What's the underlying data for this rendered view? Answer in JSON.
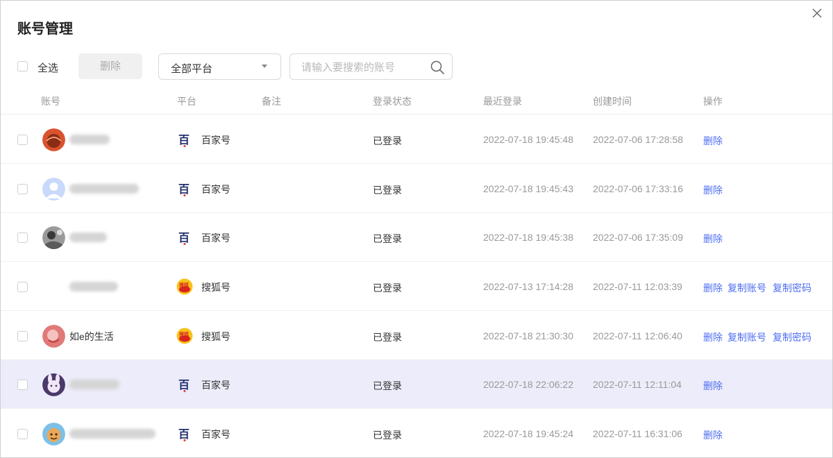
{
  "dialog": {
    "title": "账号管理"
  },
  "toolbar": {
    "select_all_label": "全选",
    "delete_label": "删除",
    "platform_value": "全部平台",
    "search_placeholder": "请输入要搜索的账号"
  },
  "table": {
    "headers": {
      "account": "账号",
      "platform": "平台",
      "note": "备注",
      "login_status": "登录状态",
      "last_login": "最近登录",
      "created": "创建时间",
      "actions": "操作"
    },
    "rows": [
      {
        "name": "",
        "platform": "百家号",
        "platform_icon": "baijiahao-icon",
        "note": "",
        "status": "已登录",
        "last_login": "2022-07-18 19:45:48",
        "created": "2022-07-06 17:28:58",
        "actions": [
          "删除"
        ]
      },
      {
        "name": "",
        "platform": "百家号",
        "platform_icon": "baijiahao-icon",
        "note": "",
        "status": "已登录",
        "last_login": "2022-07-18 19:45:43",
        "created": "2022-07-06 17:33:16",
        "actions": [
          "删除"
        ]
      },
      {
        "name": "",
        "platform": "百家号",
        "platform_icon": "baijiahao-icon",
        "note": "",
        "status": "已登录",
        "last_login": "2022-07-18 19:45:38",
        "created": "2022-07-06 17:35:09",
        "actions": [
          "删除"
        ]
      },
      {
        "name": "",
        "platform": "搜狐号",
        "platform_icon": "sohu-icon",
        "note": "",
        "status": "已登录",
        "last_login": "2022-07-13 17:14:28",
        "created": "2022-07-11 12:03:39",
        "actions": [
          "删除",
          "复制账号",
          "复制密码"
        ]
      },
      {
        "name": "如e的生活",
        "platform": "搜狐号",
        "platform_icon": "sohu-icon",
        "note": "",
        "status": "已登录",
        "last_login": "2022-07-18 21:30:30",
        "created": "2022-07-11 12:06:40",
        "actions": [
          "删除",
          "复制账号",
          "复制密码"
        ]
      },
      {
        "name": "",
        "platform": "百家号",
        "platform_icon": "baijiahao-icon",
        "note": "",
        "status": "已登录",
        "last_login": "2022-07-18 22:06:22",
        "created": "2022-07-11 12:11:04",
        "actions": [
          "删除"
        ]
      },
      {
        "name": "",
        "platform": "百家号",
        "platform_icon": "baijiahao-icon",
        "note": "",
        "status": "已登录",
        "last_login": "2022-07-18 19:45:24",
        "created": "2022-07-11 16:31:06",
        "actions": [
          "删除"
        ]
      }
    ]
  },
  "colors": {
    "link": "#4e6ef2",
    "row_highlight": "#ececfa",
    "muted_text": "#999999"
  }
}
